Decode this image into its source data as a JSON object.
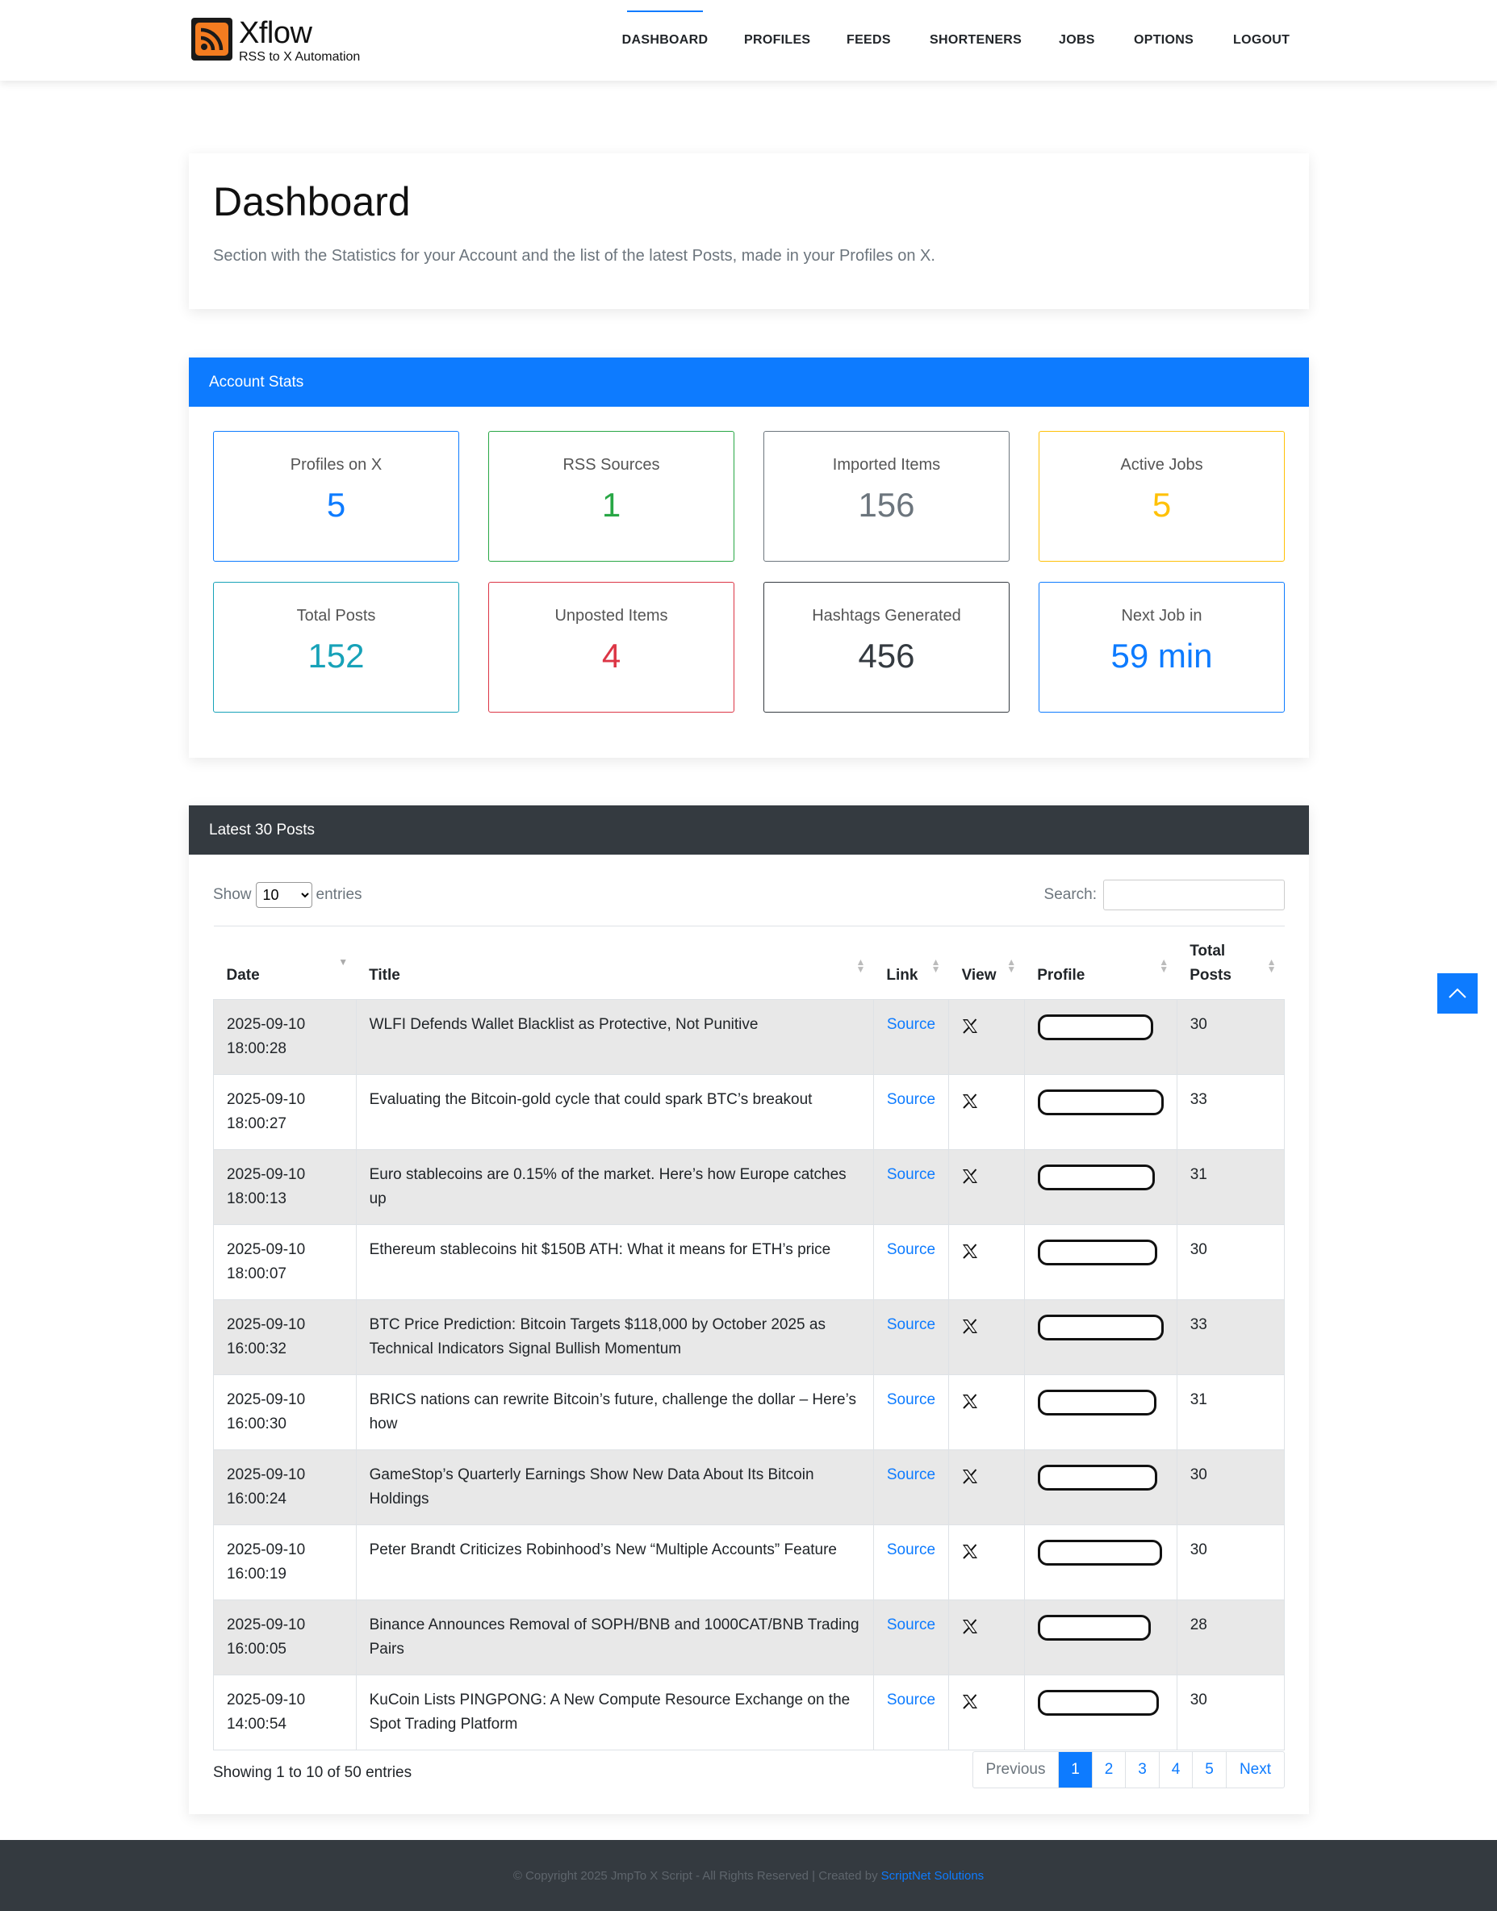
{
  "brand": {
    "name": "Xflow",
    "tagline": "RSS to X Automation"
  },
  "nav": {
    "items": [
      {
        "label": "DASHBOARD",
        "active": true
      },
      {
        "label": "PROFILES"
      },
      {
        "label": "FEEDS"
      },
      {
        "label": "SHORTENERS"
      },
      {
        "label": "JOBS"
      },
      {
        "label": "OPTIONS"
      },
      {
        "label": "LOGOUT"
      }
    ]
  },
  "intro": {
    "title": "Dashboard",
    "description": "Section with the Statistics for your Account and the list of the latest Posts, made in your Profiles on X."
  },
  "stats": {
    "header": "Account Stats",
    "items": [
      {
        "label": "Profiles on X",
        "value": "5",
        "color": "#0d7bff"
      },
      {
        "label": "RSS Sources",
        "value": "1",
        "color": "#28a745"
      },
      {
        "label": "Imported Items",
        "value": "156",
        "color": "#6c757d"
      },
      {
        "label": "Active Jobs",
        "value": "5",
        "color": "#ffc107"
      },
      {
        "label": "Total Posts",
        "value": "152",
        "color": "#17a2b8"
      },
      {
        "label": "Unposted Items",
        "value": "4",
        "color": "#dc3545"
      },
      {
        "label": "Hashtags Generated",
        "value": "456",
        "color": "#343a40"
      },
      {
        "label": "Next Job in",
        "value": "59 min",
        "color": "#0d7bff"
      }
    ]
  },
  "posts": {
    "header": "Latest 30 Posts",
    "show_label": "Show",
    "entries_label": "entries",
    "page_size": "10",
    "search_label": "Search:",
    "search_value": "",
    "columns": [
      "Date",
      "Title",
      "Link",
      "View",
      "Profile",
      "Total Posts"
    ],
    "rows": [
      {
        "date": "2025-09-10",
        "time": "18:00:28",
        "title": "WLFI Defends Wallet Blacklist as Protective, Not Punitive",
        "link": "Source",
        "total": "30"
      },
      {
        "date": "2025-09-10",
        "time": "18:00:27",
        "title": "Evaluating the Bitcoin-gold cycle that could spark BTC’s breakout",
        "link": "Source",
        "total": "33"
      },
      {
        "date": "2025-09-10",
        "time": "18:00:13",
        "title": "Euro stablecoins are 0.15% of the market. Here’s how Europe catches up",
        "link": "Source",
        "total": "31"
      },
      {
        "date": "2025-09-10",
        "time": "18:00:07",
        "title": "Ethereum stablecoins hit $150B ATH: What it means for ETH’s price",
        "link": "Source",
        "total": "30"
      },
      {
        "date": "2025-09-10",
        "time": "16:00:32",
        "title": "BTC Price Prediction: Bitcoin Targets $118,000 by October 2025 as Technical Indicators Signal Bullish Momentum",
        "link": "Source",
        "total": "33"
      },
      {
        "date": "2025-09-10",
        "time": "16:00:30",
        "title": "BRICS nations can rewrite Bitcoin’s future, challenge the dollar – Here’s how",
        "link": "Source",
        "total": "31"
      },
      {
        "date": "2025-09-10",
        "time": "16:00:24",
        "title": "GameStop’s Quarterly Earnings Show New Data About Its Bitcoin Holdings",
        "link": "Source",
        "total": "30"
      },
      {
        "date": "2025-09-10",
        "time": "16:00:19",
        "title": "Peter Brandt Criticizes Robinhood’s New “Multiple Accounts” Feature",
        "link": "Source",
        "total": "30"
      },
      {
        "date": "2025-09-10",
        "time": "16:00:05",
        "title": "Binance Announces Removal of SOPH/BNB and 1000CAT/BNB Trading Pairs",
        "link": "Source",
        "total": "28"
      },
      {
        "date": "2025-09-10",
        "time": "14:00:54",
        "title": "KuCoin Lists PINGPONG: A New Compute Resource Exchange on the Spot Trading Platform",
        "link": "Source",
        "total": "30"
      }
    ],
    "summary": "Showing 1 to 10 of 50 entries",
    "pagination": {
      "previous": "Previous",
      "pages": [
        "1",
        "2",
        "3",
        "4",
        "5"
      ],
      "current": "1",
      "next": "Next"
    }
  },
  "footer": {
    "text": "© Copyright 2025 JmpTo X Script - All Rights Reserved | Created by",
    "link": "ScriptNet Solutions"
  },
  "icons": {
    "logo": "rss-icon",
    "view": "x-logo-icon",
    "scroll_top": "chevron-up-icon",
    "sort": "sort-arrows-icon"
  },
  "colors": {
    "accent": "#0d7bff",
    "dark_header": "#343a40",
    "brand_orange": "#f47c20"
  }
}
